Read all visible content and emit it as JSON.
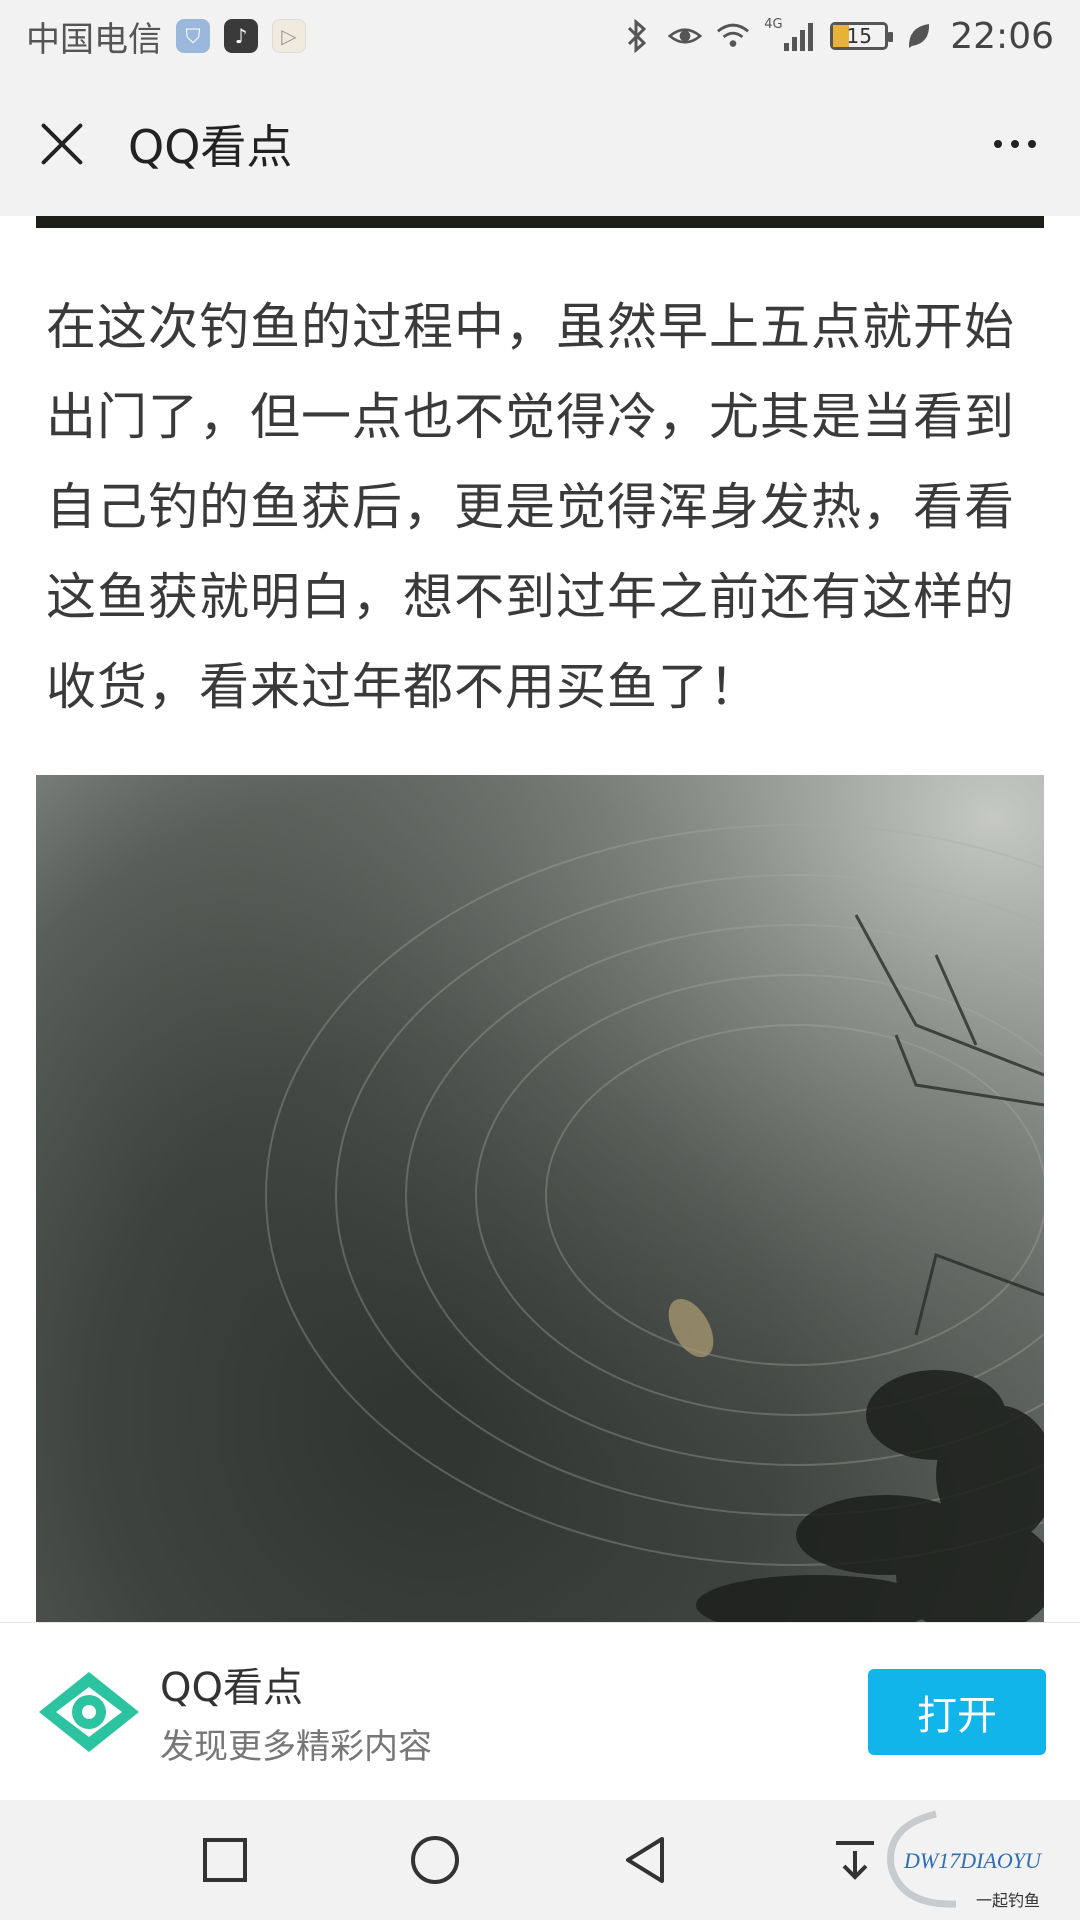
{
  "status_bar": {
    "carrier": "中国电信",
    "battery": "15",
    "network": "4G",
    "time": "22:06",
    "icons": [
      "bluetooth-icon",
      "eye-comfort-icon",
      "wifi-icon",
      "signal-icon",
      "battery-icon",
      "leaf-icon"
    ]
  },
  "topnav": {
    "title": "QQ看点",
    "close_icon": "close-icon",
    "more_icon": "more-icon"
  },
  "article": {
    "paragraph": "在这次钓鱼的过程中，虽然早上五点就开始出门了，但一点也不觉得冷，尤其是当看到自己钓的鱼获后，更是觉得浑身发热，看看这鱼获就明白，想不到过年之前还有这样的收货，看来过年都不用买鱼了！"
  },
  "banner": {
    "app_name": "QQ看点",
    "tagline": "发现更多精彩内容",
    "open_label": "打开",
    "brand_color": "#12b5ea",
    "logo_color": "#2cc3a0"
  },
  "navbar": {
    "icons": [
      "recent-apps-icon",
      "home-icon",
      "back-icon",
      "notification-drawer-icon"
    ]
  },
  "watermark": {
    "text": "DW17DIAOYU",
    "sub_text": "一起钓鱼"
  }
}
